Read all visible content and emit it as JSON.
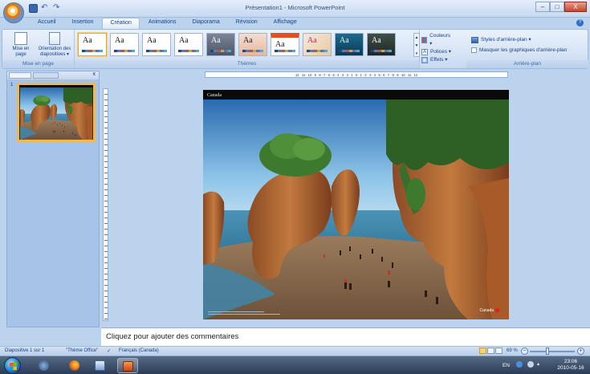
{
  "window": {
    "title": "Présentation1 - Microsoft PowerPoint",
    "controls": [
      "–",
      "□",
      "X"
    ]
  },
  "tabs": [
    "Accueil",
    "Insertion",
    "Création",
    "Animations",
    "Diaporama",
    "Révision",
    "Affichage"
  ],
  "active_tab": "Création",
  "ribbon": {
    "page_setup": {
      "mise_en_page_line1": "Mise en",
      "mise_en_page_line2": "page",
      "orientation_line1": "Orientation des",
      "orientation_line2": "diapositives ▾",
      "group_label": "Mise en page"
    },
    "themes": {
      "sample": "Aa",
      "count": 10,
      "group_label": "Thèmes",
      "colors_label": "Couleurs ▾",
      "fonts_label": "Polices ▾",
      "effects_label": "Effets ▾"
    },
    "background": {
      "styles_label": "Styles d'arrière-plan ▾",
      "hide_graphics_label": "Masquer les graphiques d'arrière-plan",
      "group_label": "Arrière-plan"
    }
  },
  "slides_panel": {
    "close": "x",
    "thumb_number": "1"
  },
  "ruler": {
    "horizontal": "· 12 · 11 · 10 · 9 · 8 · 7 · 6 · 5 · 4 · 3 · 2 · 1 · 0 · 1 · 2 · 3 · 4 · 5 · 6 · 7 · 8 · 9 · 10 · 11 · 12 ·"
  },
  "slide": {
    "caption": "Canada",
    "logo_text": "Canada"
  },
  "notes": {
    "placeholder": "Cliquez pour ajouter des commentaires"
  },
  "status_bar": {
    "slide_info": "Diapositive 1 sur 1",
    "theme": "\"Thème Office\"",
    "language": "Français (Canada)",
    "zoom": "69 %"
  },
  "taskbar": {
    "lang": "EN",
    "time": "23:06",
    "date": "2010-05-16"
  },
  "colors": {
    "ribbon_text": "#15428b",
    "selected_accent": "#f3b84a",
    "background": "#bcd3ee"
  }
}
